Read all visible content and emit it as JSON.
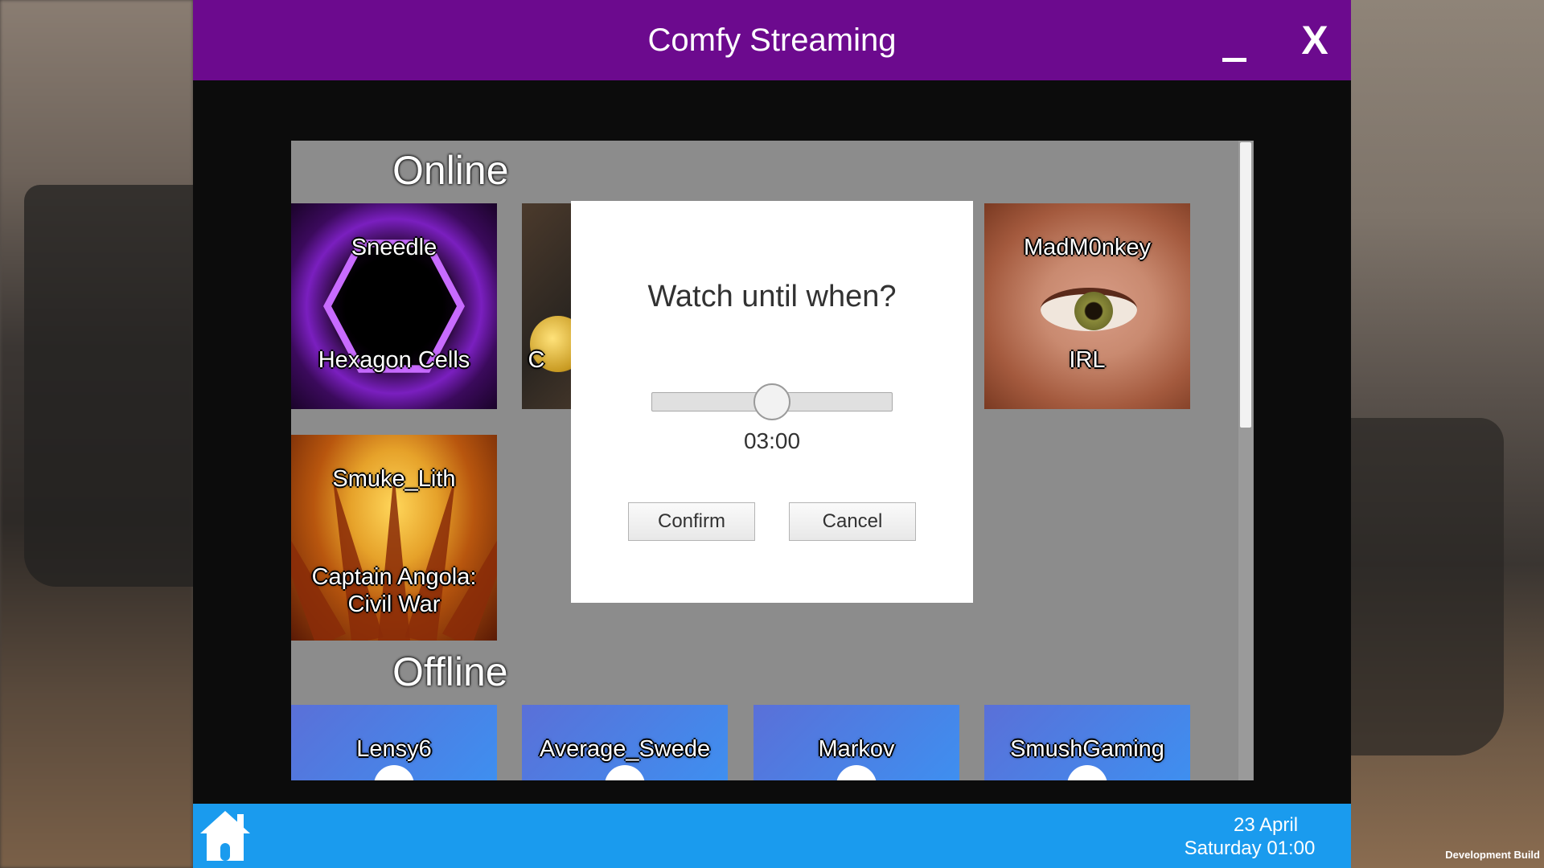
{
  "window": {
    "title": "Comfy Streaming",
    "minimize_label": "_",
    "close_label": "X"
  },
  "sections": {
    "online_title": "Online",
    "offline_title": "Offline"
  },
  "online_streams": [
    {
      "name": "Sneedle",
      "game": "Hexagon Cells"
    },
    {
      "name": "",
      "game": "C"
    },
    {
      "name": "MadM0nkey",
      "game": "IRL"
    },
    {
      "name": "Smuke_Lith",
      "game": "Captain Angola: Civil War"
    }
  ],
  "offline_streams": [
    {
      "name": "Lensy6"
    },
    {
      "name": "Average_Swede"
    },
    {
      "name": "Markov"
    },
    {
      "name": "SmushGaming"
    }
  ],
  "modal": {
    "title": "Watch until when?",
    "slider_value": "03:00",
    "slider_fraction": 0.5,
    "confirm_label": "Confirm",
    "cancel_label": "Cancel"
  },
  "taskbar": {
    "date": "23 April",
    "day_time": "Saturday 01:00"
  },
  "footer": {
    "build_label": "Development Build"
  },
  "colors": {
    "titlebar": "#6c0a8e",
    "taskbar": "#1a9bee",
    "panel": "#8c8c8c"
  },
  "icons": [
    "home-icon",
    "minimize-icon",
    "close-icon"
  ]
}
